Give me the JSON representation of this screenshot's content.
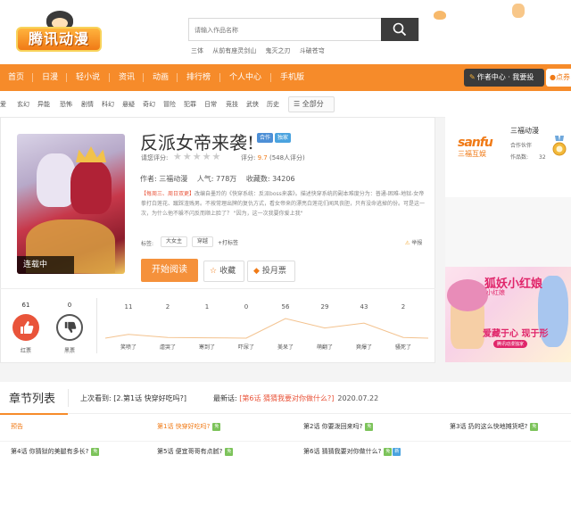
{
  "header": {
    "logo_text": "腾讯动漫",
    "search_placeholder": "请输入作品名称",
    "hot_words": [
      "三体",
      "从前有座灵剑山",
      "鬼灭之刃",
      "斗破苍穹"
    ]
  },
  "nav": {
    "items": [
      "首页",
      "日漫",
      "轻小说",
      "资讯",
      "动画",
      "排行榜",
      "个人中心",
      "手机版"
    ],
    "author_center": "作者中心 · 我要投",
    "points": "点券"
  },
  "categories": {
    "items": [
      "爱",
      "玄幻",
      "异能",
      "恐怖",
      "剧情",
      "科幻",
      "悬疑",
      "奇幻",
      "冒险",
      "犯罪",
      "日常",
      "竞技",
      "武侠",
      "历史"
    ],
    "all_label": "全部分"
  },
  "comic": {
    "cover_tag": "连载中",
    "title": "反派女帝来袭!",
    "badges": [
      {
        "label": "合作",
        "color": "#4d8fd6"
      },
      {
        "label": "独家",
        "color": "#4aa3df"
      }
    ],
    "rate_label": "请您评分:",
    "score_prefix": "评分:",
    "score": "9.7",
    "score_suffix": "(548人评分)",
    "author_line": "作者:  三福动漫",
    "popularity": "人气:  778万",
    "favorites": "收藏数:  34206",
    "desc_highlight": "【每周三、周日双更】",
    "description": "改编自墨玲的《快穿系统：反派boss来袭》。描述快穿系统的副本难度分为：普通-困难-地狱-女帝 拳打白莲花、蹴踩渣贱男。不按常理出牌的复仇方式，看女帝来的漂亮白莲花们闻风丧胆，只有没命逃掉的份。可是这一次，为什么他不躲不闪反而顺上脸了？ \"因为，这一次我要你爱上我\"",
    "tags_label": "标签:",
    "tags": [
      "大女主",
      "穿越"
    ],
    "add_tag": "+打标签",
    "report": "举报",
    "read_button": "开始阅读",
    "collect_button": "收藏",
    "monthly_vote_button": "投月票"
  },
  "reactions": {
    "red": {
      "count": "61",
      "label": "红票"
    },
    "black": {
      "count": "0",
      "label": "黑票"
    },
    "emotions": [
      {
        "count": "11",
        "label": "笑喷了"
      },
      {
        "count": "2",
        "label": "虐哭了"
      },
      {
        "count": "1",
        "label": "寒到了"
      },
      {
        "count": "0",
        "label": "吓尿了"
      },
      {
        "count": "56",
        "label": "美呆了"
      },
      {
        "count": "29",
        "label": "萌翻了"
      },
      {
        "count": "43",
        "label": "爽爆了"
      },
      {
        "count": "2",
        "label": "骚死了"
      }
    ]
  },
  "author_panel": {
    "logo_main": "sanfu",
    "logo_sub": "三福互娱",
    "name": "三福动漫",
    "role": "合作伙伴",
    "works_label": "作品数:",
    "works_count": "32"
  },
  "ad": {
    "title": "狐妖小红娘",
    "subtitle": "小红娘",
    "slogan": "爱藏于心 现于形",
    "small": "腾讯动漫独家"
  },
  "chapters": {
    "section_title": "章节列表",
    "last_read_label": "上次看到:",
    "last_read": "[2.第1话 快穿好吃吗?]",
    "latest_label": "最新话:",
    "latest": "[第6话 猜猜我要对你做什么?]",
    "latest_date": "2020.07.22",
    "free_badge": "免",
    "new_badge": "新",
    "list": [
      {
        "title": "预告",
        "highlight": true
      },
      {
        "title": "第1话 快穿好吃吗?",
        "highlight": true
      },
      {
        "title": "第2话 你要泼回来吗?",
        "highlight": false
      },
      {
        "title": "第3话 扔的这么快地摊货吧?",
        "highlight": false
      },
      {
        "title": "第4话 你猜狱的美腿有多长?",
        "highlight": false
      },
      {
        "title": "第5话 便宜哥哥有点腻?",
        "highlight": false
      },
      {
        "title": "第6话 猜猜我要对你做什么?",
        "highlight": false
      }
    ]
  }
}
